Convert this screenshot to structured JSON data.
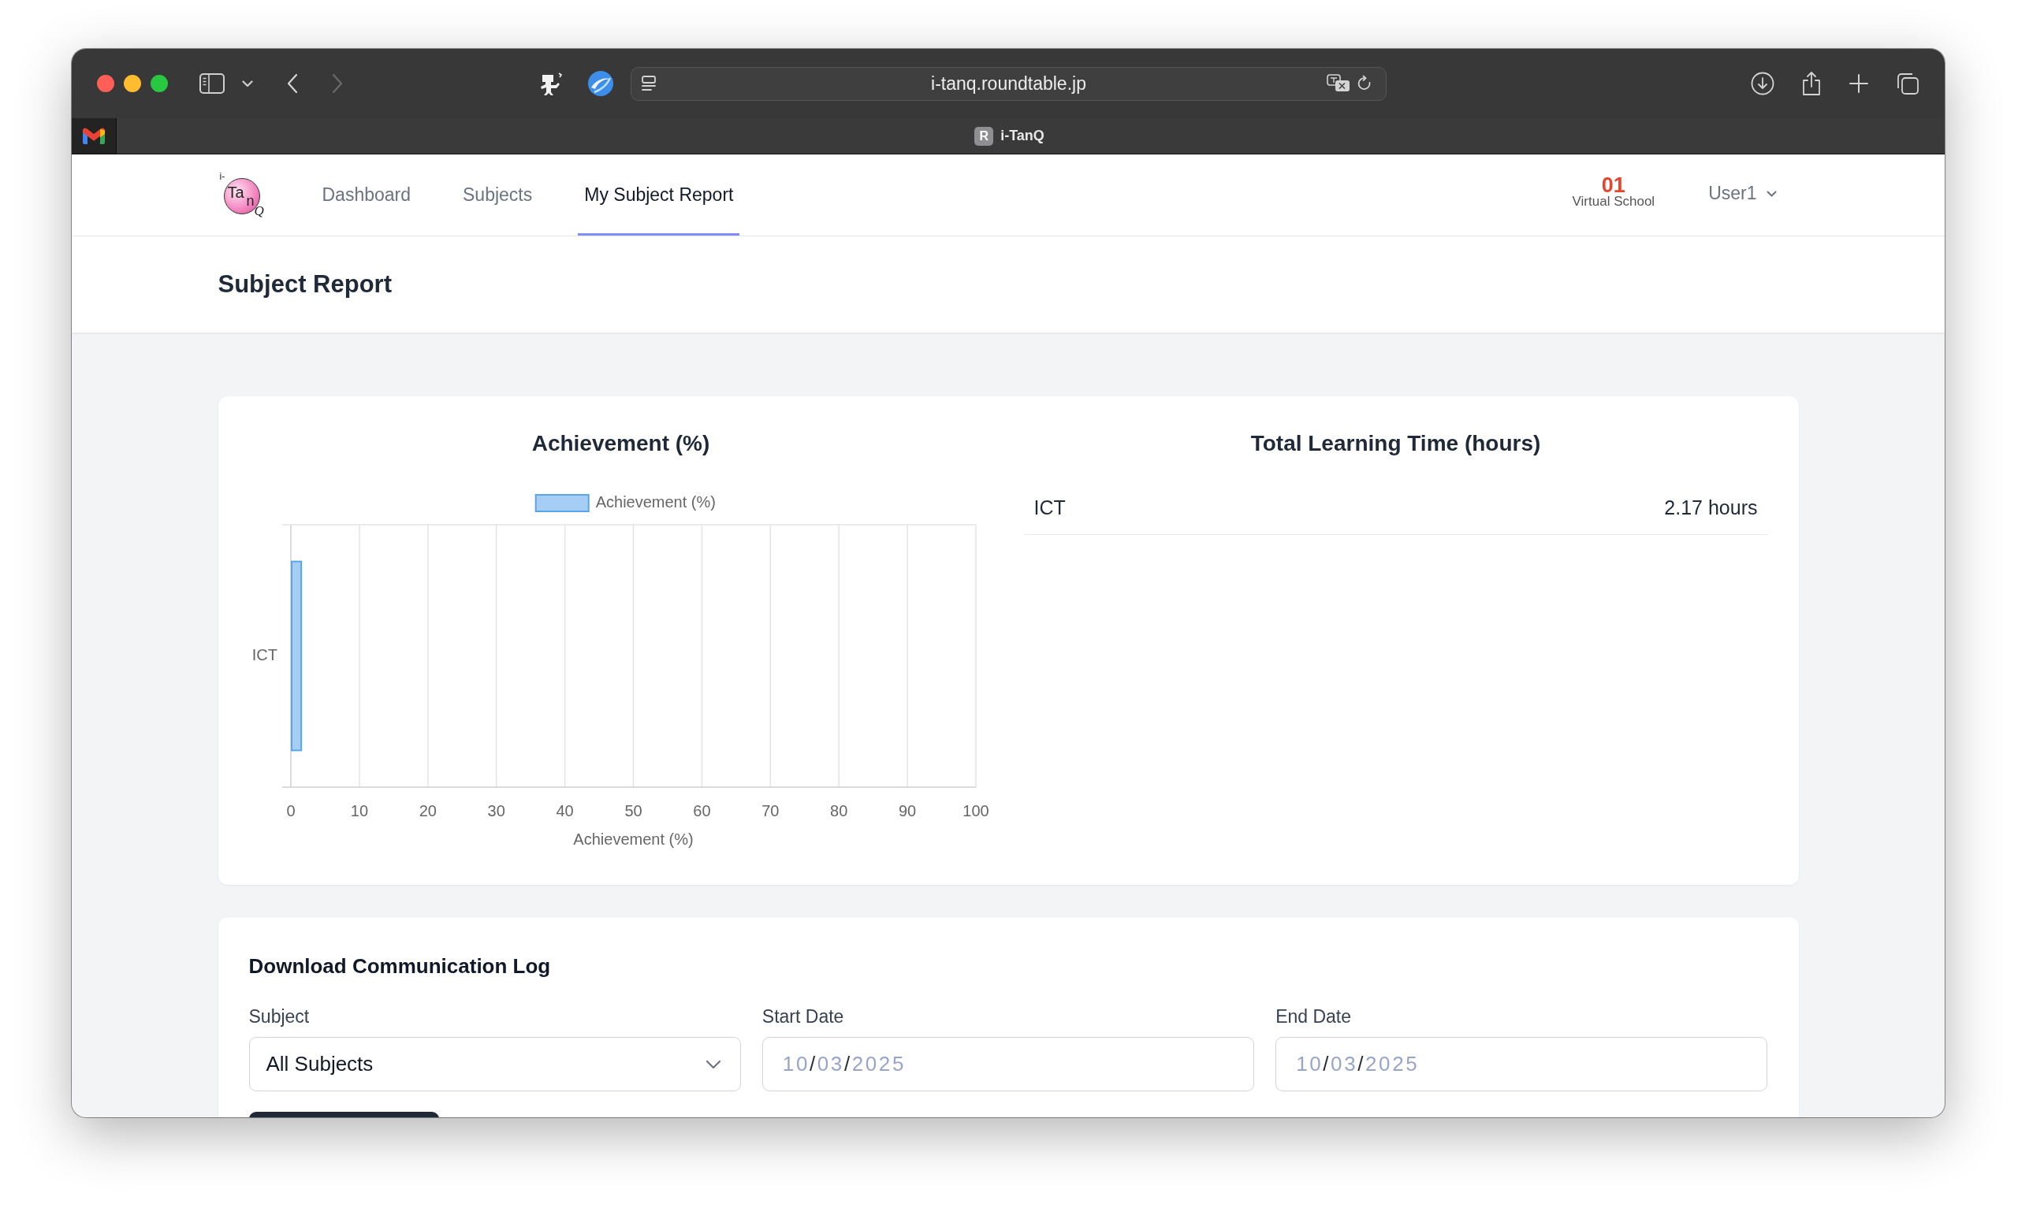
{
  "browser": {
    "nav_buttons": [
      {
        "kind": "back",
        "disabled": false
      },
      {
        "kind": "forward",
        "disabled": true
      }
    ],
    "address_bar": {
      "url": "i-tanq.roundtable.jp"
    },
    "tabs": [
      {
        "kind": "pinned",
        "selected": false
      },
      {
        "kind": "page",
        "favicon": "R",
        "title": "i-TanQ",
        "selected": true
      }
    ]
  },
  "navbar": {
    "logo": {
      "letters": [
        "i-",
        "Ta",
        "n",
        "Q"
      ]
    },
    "links": [
      {
        "label": "Dashboard",
        "selected": false
      },
      {
        "label": "Subjects",
        "selected": false
      },
      {
        "label": "My Subject Report",
        "selected": true
      }
    ],
    "school": {
      "number": "01",
      "name": "Virtual School"
    },
    "user_menu": {
      "label": "User1"
    }
  },
  "page_header": {
    "title": "Subject Report"
  },
  "report_card": {
    "achievement": {
      "chart_data": {
        "type": "bar",
        "orientation": "horizontal",
        "title": "Achievement (%)",
        "xlabel": "Achievement (%)",
        "categories": [
          "ICT"
        ],
        "series": [
          {
            "name": "Achievement (%)",
            "color": "#a6cdf3",
            "values": [
              1.4
            ]
          }
        ],
        "xlim": [
          0,
          100
        ],
        "xticks": [
          0,
          10,
          20,
          30,
          40,
          50,
          60,
          70,
          80,
          90,
          100
        ],
        "grid": true
      }
    },
    "learning_time": {
      "title": "Total Learning Time (hours)",
      "rows": [
        {
          "subject": "ICT",
          "hours": "2.17 hours"
        }
      ]
    }
  },
  "communication_log": {
    "title": "Download Communication Log",
    "fields": [
      {
        "kind": "select",
        "label": "Subject",
        "value": "All Subjects"
      },
      {
        "kind": "date",
        "label": "Start Date",
        "value": "10/03/2025"
      },
      {
        "kind": "date",
        "label": "End Date",
        "value": "10/03/2025"
      }
    ]
  }
}
